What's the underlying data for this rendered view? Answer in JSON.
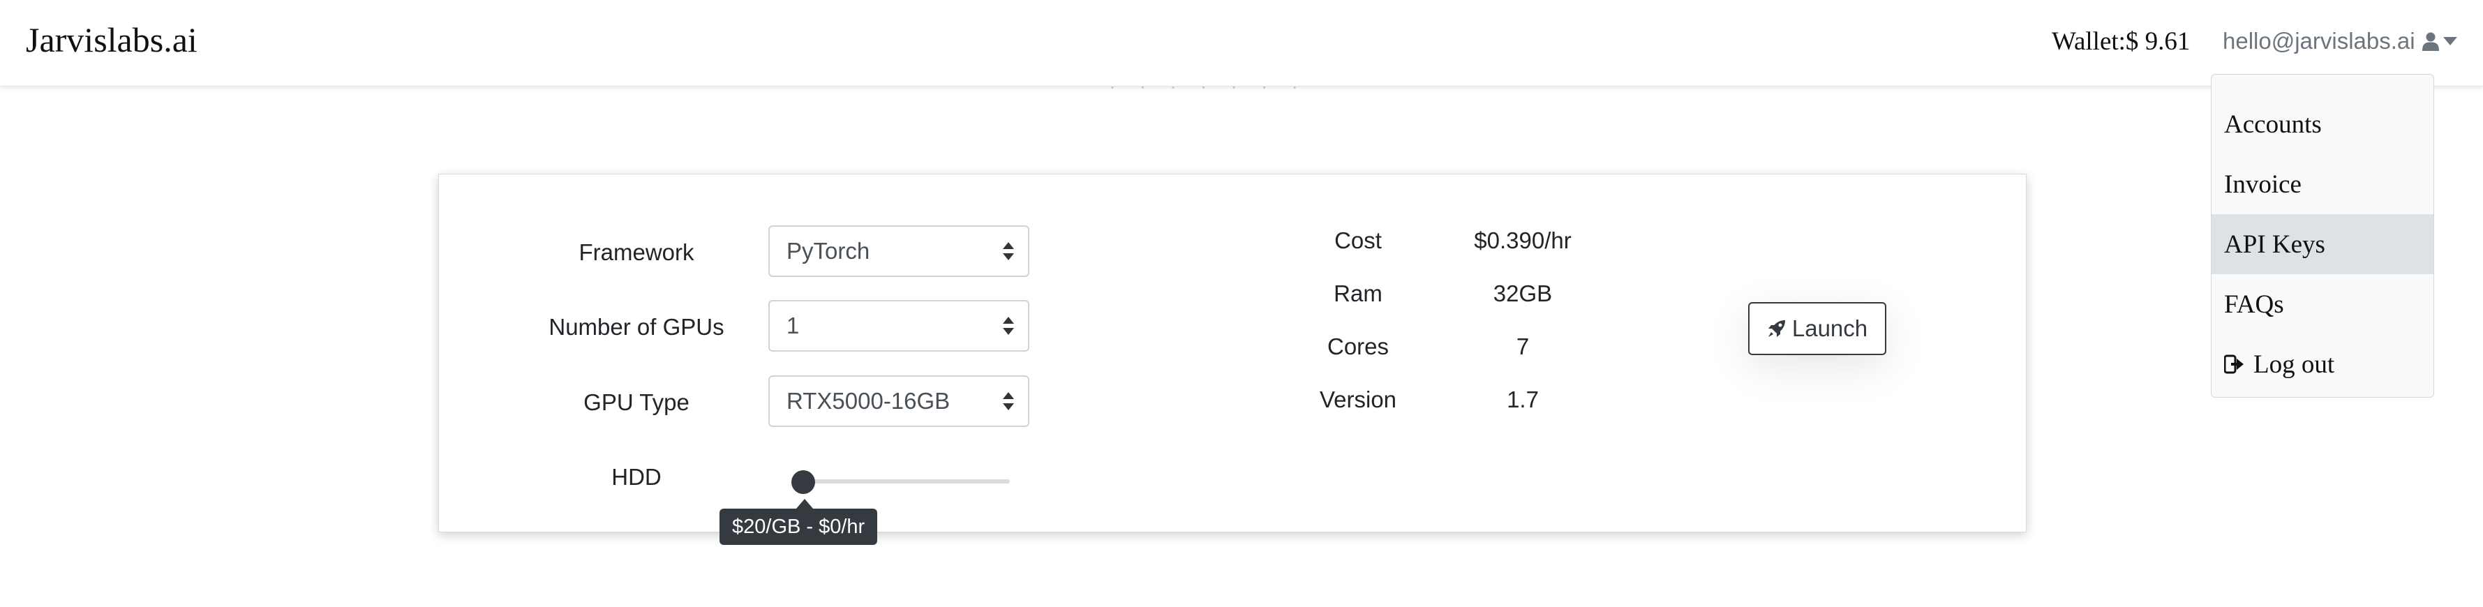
{
  "navbar": {
    "brand": "Jarvislabs.ai",
    "wallet": "Wallet:$ 9.61",
    "user_email": "hello@jarvislabs.ai",
    "user_icon": "user-icon",
    "caret_icon": "caret-down-icon"
  },
  "dropdown": {
    "items": [
      {
        "label": "Accounts"
      },
      {
        "label": "Invoice"
      },
      {
        "label": "API Keys",
        "active": true
      },
      {
        "label": "FAQs"
      },
      {
        "label": "Log out",
        "icon": "logout-icon"
      }
    ]
  },
  "form": {
    "framework": {
      "label": "Framework",
      "value": "PyTorch"
    },
    "num_gpus": {
      "label": "Number of GPUs",
      "value": "1"
    },
    "gpu_type": {
      "label": "GPU Type",
      "value": "RTX5000-16GB"
    },
    "hdd": {
      "label": "HDD",
      "tooltip": "$20/GB - $0/hr",
      "level": 0
    }
  },
  "stats": {
    "cost": {
      "label": "Cost",
      "value": "$0.390/hr"
    },
    "ram": {
      "label": "Ram",
      "value": "32GB"
    },
    "cores": {
      "label": "Cores",
      "value": "7"
    },
    "version": {
      "label": "Version",
      "value": "1.7"
    }
  },
  "launch": {
    "label": "Launch",
    "icon": "rocket-icon"
  },
  "colors": {
    "dark": "#343a40",
    "muted": "#6c757d",
    "dropdown_bg": "#f8f9fa",
    "active_bg": "#dee2e6"
  }
}
